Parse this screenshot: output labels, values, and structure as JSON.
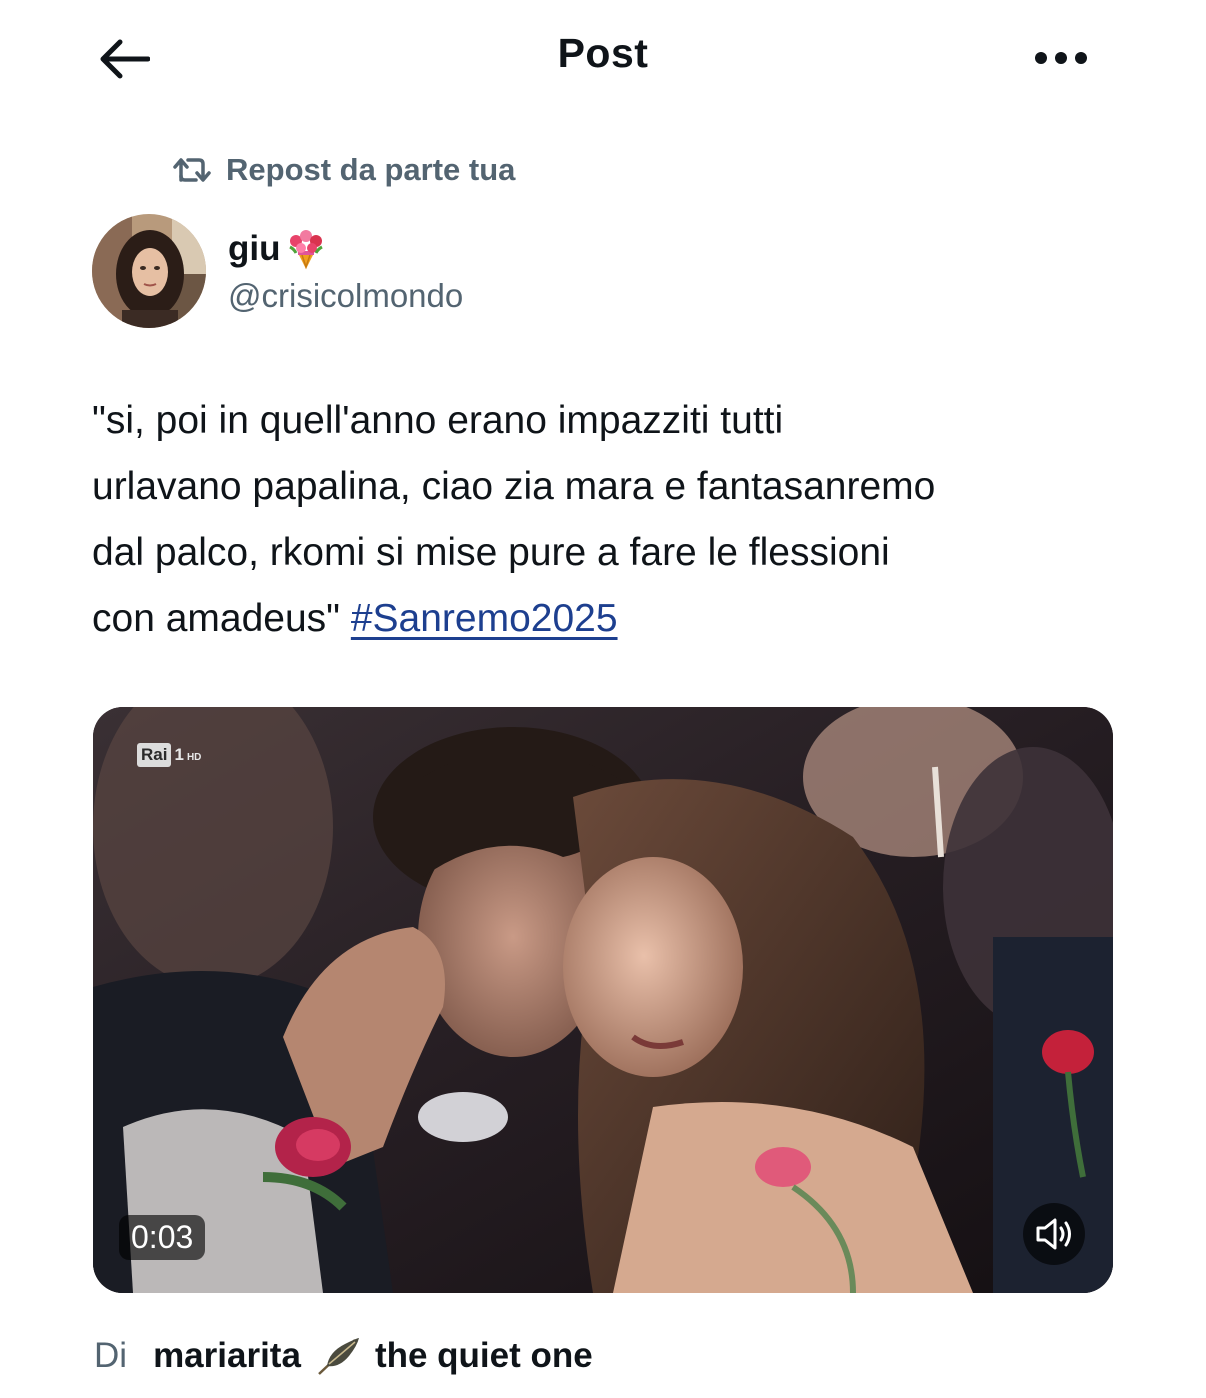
{
  "header": {
    "title": "Post",
    "back_icon": "arrow-left-icon",
    "more_icon": "more-horizontal-icon"
  },
  "repost": {
    "label": "Repost da parte tua",
    "icon": "repost-icon"
  },
  "author": {
    "display_name": "giu",
    "display_name_emoji": "bouquet-icon",
    "handle": "@crisicolmondo"
  },
  "tweet": {
    "lines": [
      "\"si, poi in quell'anno erano impazziti tutti",
      "urlavano papalina, ciao zia mara e fantasanremo",
      "dal palco, rkomi si mise pure a fare le flessioni",
      "con amadeus\" "
    ],
    "hashtag": "#Sanremo2025"
  },
  "video": {
    "channel_logo": "Rai",
    "channel_number": "1",
    "channel_hd": "HD",
    "timestamp": "0:03",
    "sound_icon": "speaker-muted-icon"
  },
  "attribution": {
    "prefix": "Di",
    "name": "mariarita",
    "emoji": "feather-icon",
    "name_suffix": "the quiet one"
  },
  "colors": {
    "text": "#0f1419",
    "secondary": "#536471",
    "hashtag": "#1d3f8f",
    "background": "#ffffff"
  }
}
